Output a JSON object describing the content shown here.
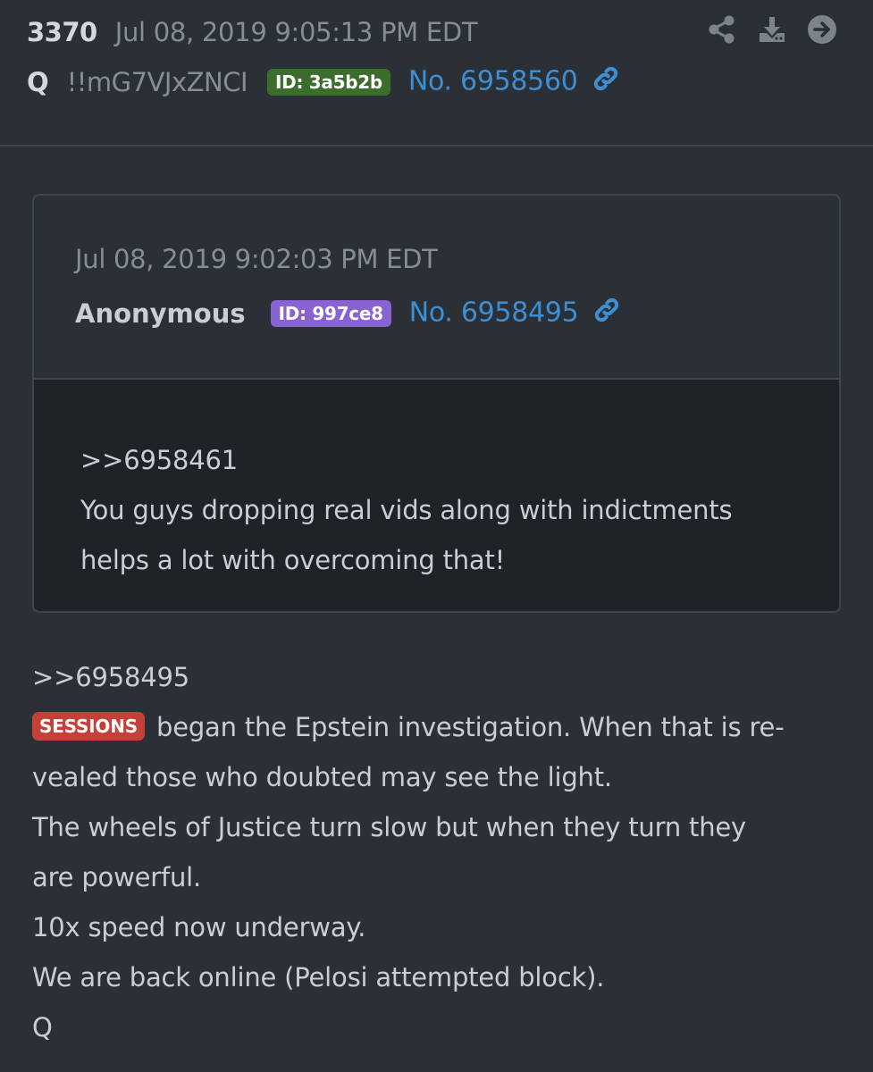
{
  "post": {
    "number": "3370",
    "date": "Jul 08, 2019 9:05:13 PM EDT",
    "author": "Q",
    "tripcode": "!!mG7VJxZNCI",
    "id_label": "ID: 3a5b2b",
    "id_color": "#3b6d2c",
    "post_link": "No. 6958560"
  },
  "actions": {
    "share_icon": "share-icon",
    "download_icon": "download-icon",
    "next_icon": "arrow-right-circle-icon"
  },
  "quoted_post": {
    "date": "Jul 08, 2019 9:02:03 PM EDT",
    "author": "Anonymous",
    "id_label": "ID: 997ce8",
    "id_color": "#8a63d2",
    "post_link": "No. 6958495",
    "lines": [
      ">>6958461",
      "You guys dropping real vids along with indictments",
      "helps a lot with overcoming that!"
    ]
  },
  "body": {
    "reply_ref": ">>6958495",
    "tag": "SESSIONS",
    "tag_color": "#c6403a",
    "line1_rest": " began the Epstein investigation. When that is re-",
    "lines": [
      "vealed those who doubted may see the light.",
      "The wheels of Justice turn slow but when they turn they",
      "are powerful.",
      "10x speed now underway.",
      "We are back online (Pelosi attempted block).",
      "Q"
    ]
  },
  "colors": {
    "background": "#2b3037",
    "quote_body": "#1f2226",
    "link": "#3c8fd4"
  }
}
